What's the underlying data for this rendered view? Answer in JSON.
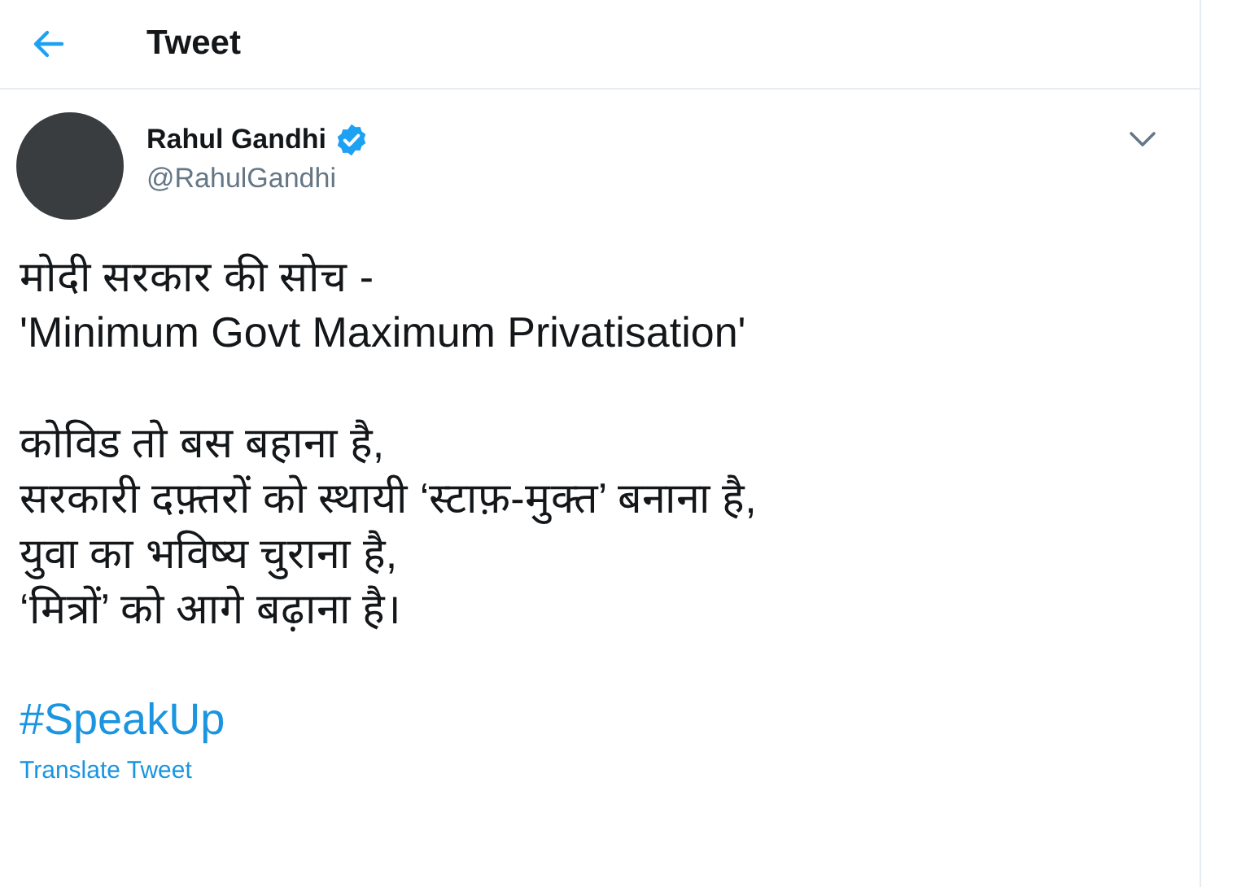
{
  "header": {
    "title": "Tweet"
  },
  "tweet": {
    "author": {
      "name": "Rahul Gandhi",
      "verified": true,
      "handle": "@RahulGandhi"
    },
    "paragraphs": [
      [
        "मोदी सरकार की सोच -",
        "'Minimum Govt Maximum Privatisation'"
      ],
      [
        "कोविड तो बस बहाना है,",
        "सरकारी दफ़्तरों को स्थायी ‘स्टाफ़-मुक्त’ बनाना है,",
        "युवा का भविष्य चुराना है,",
        "‘मित्रों’ को आगे बढ़ाना है।"
      ]
    ],
    "hashtag": "#SpeakUp",
    "translate_link": "Translate Tweet"
  }
}
